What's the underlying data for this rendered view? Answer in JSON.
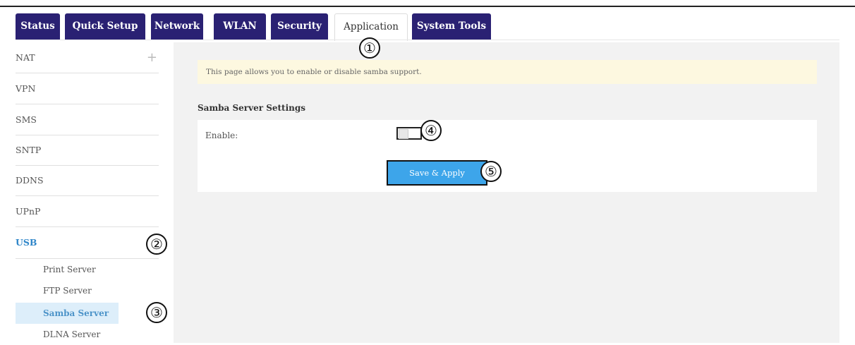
{
  "tabs": [
    {
      "label": "Status"
    },
    {
      "label": "Quick Setup"
    },
    {
      "label": "Network"
    },
    {
      "label": "WLAN"
    },
    {
      "label": "Security"
    },
    {
      "label": "Application",
      "active": true
    },
    {
      "label": "System Tools"
    }
  ],
  "sidebar": {
    "items": [
      {
        "label": "NAT",
        "expand_symbol": "+"
      },
      {
        "label": "VPN"
      },
      {
        "label": "SMS"
      },
      {
        "label": "SNTP"
      },
      {
        "label": "DDNS"
      },
      {
        "label": "UPnP"
      },
      {
        "label": "USB",
        "active": true
      }
    ],
    "subitems": [
      {
        "label": "Print Server"
      },
      {
        "label": "FTP Server"
      },
      {
        "label": "Samba Server",
        "active": true
      },
      {
        "label": "DLNA Server"
      }
    ]
  },
  "main": {
    "notice": "This page allows you to enable or disable samba support.",
    "section_title": "Samba Server Settings",
    "enable_label": "Enable:",
    "enable_checked": false,
    "apply_button": "Save & Apply"
  },
  "callouts": [
    "①",
    "②",
    "③",
    "④",
    "⑤"
  ],
  "colors": {
    "tab_bg": "#2a2173",
    "accent_blue": "#3da5ea",
    "active_link": "#2f86c9",
    "notice_bg": "#fdf8e0",
    "content_bg": "#f2f2f2"
  }
}
